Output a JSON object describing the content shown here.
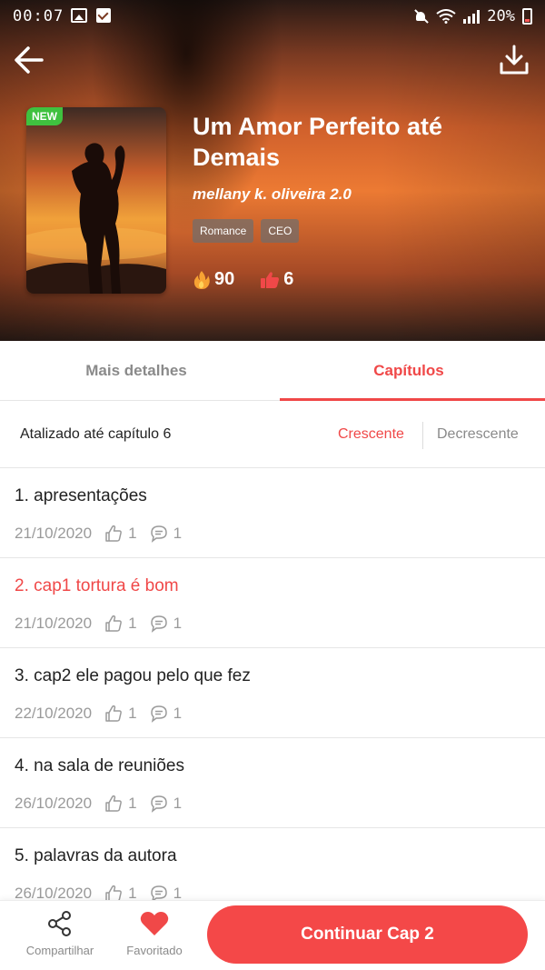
{
  "status_bar": {
    "time": "00:07",
    "battery": "20%"
  },
  "book": {
    "badge": "NEW",
    "title": "Um Amor Perfeito até Demais",
    "author": "mellany k. oliveira 2.0",
    "tags": [
      "Romance",
      "CEO"
    ],
    "views": "90",
    "likes": "6"
  },
  "tabs": [
    {
      "label": "Mais detalhes",
      "active": false
    },
    {
      "label": "Capítulos",
      "active": true
    }
  ],
  "sort": {
    "label": "Atalizado até capítulo 6",
    "ascending": "Crescente",
    "descending": "Decrescente"
  },
  "chapters": [
    {
      "title": "1. apresentações",
      "date": "21/10/2020",
      "likes": "1",
      "comments": "1"
    },
    {
      "title": "2. cap1 tortura é bom",
      "date": "21/10/2020",
      "likes": "1",
      "comments": "1"
    },
    {
      "title": "3. cap2 ele pagou pelo que fez",
      "date": "22/10/2020",
      "likes": "1",
      "comments": "1"
    },
    {
      "title": "4. na sala de reuniões",
      "date": "26/10/2020",
      "likes": "1",
      "comments": "1"
    },
    {
      "title": "5. palavras da autora",
      "date": "26/10/2020",
      "likes": "1",
      "comments": "1"
    }
  ],
  "bottom_bar": {
    "share_label": "Compartilhar",
    "favorite_label": "Favoritado",
    "continue_label": "Continuar Cap 2"
  },
  "colors": {
    "accent": "#f04848",
    "badge_green": "#3fc13f",
    "muted": "#8a8a8a"
  }
}
